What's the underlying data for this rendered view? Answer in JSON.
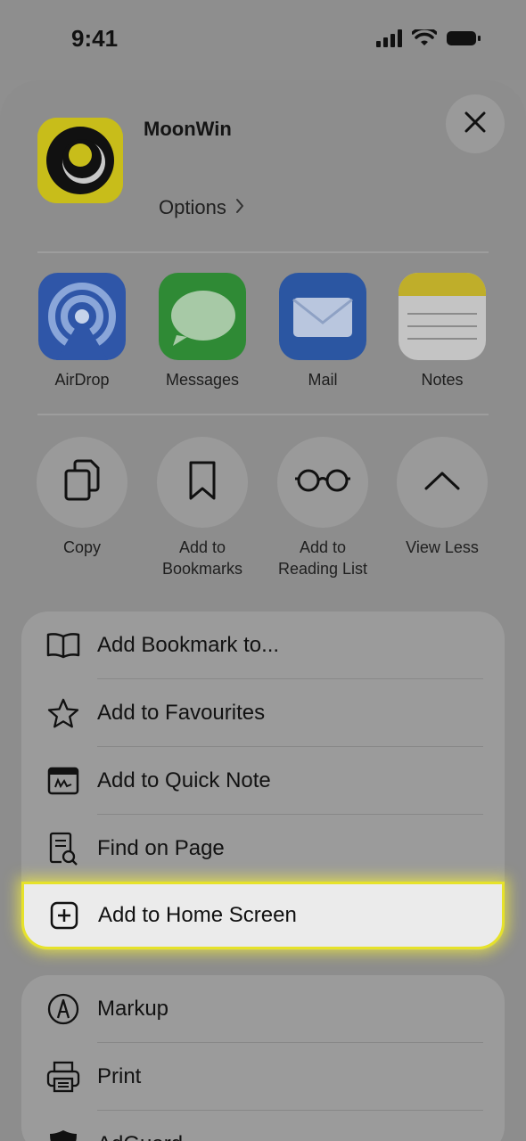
{
  "status_bar": {
    "time": "9:41"
  },
  "header": {
    "app_title": "MoonWin",
    "options_label": "Options"
  },
  "share_targets": [
    {
      "label": "AirDrop"
    },
    {
      "label": "Messages"
    },
    {
      "label": "Mail"
    },
    {
      "label": "Notes"
    }
  ],
  "actions": [
    {
      "label": "Copy"
    },
    {
      "label": "Add to\nBookmarks"
    },
    {
      "label": "Add to\nReading List"
    },
    {
      "label": "View Less"
    }
  ],
  "menu": {
    "group1": [
      {
        "label": "Add Bookmark to..."
      },
      {
        "label": "Add to Favourites"
      },
      {
        "label": "Add to Quick Note"
      },
      {
        "label": "Find on Page"
      }
    ],
    "highlighted": {
      "label": "Add to Home Screen"
    },
    "group2": [
      {
        "label": "Markup"
      },
      {
        "label": "Print"
      },
      {
        "label": "AdGuard"
      }
    ]
  },
  "colors": {
    "highlight_border": "#e6e22a",
    "dim_overlay": "#8e8e8e",
    "app_icon_bg": "#c8bd1a"
  }
}
